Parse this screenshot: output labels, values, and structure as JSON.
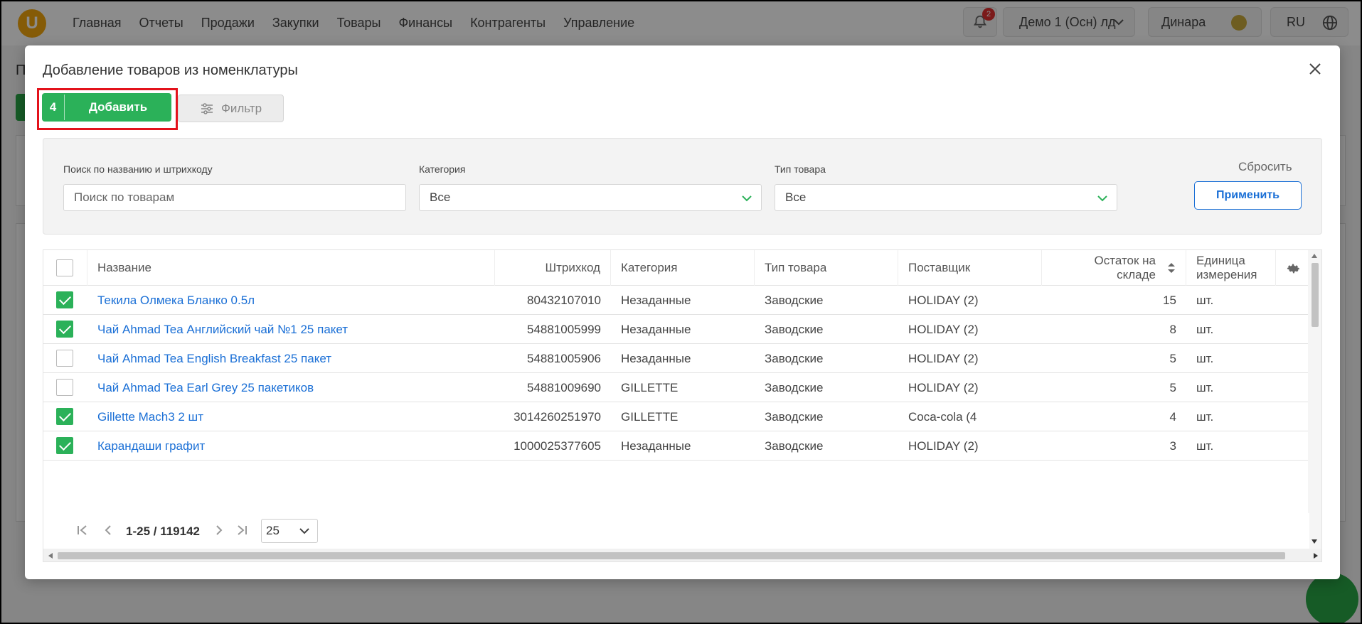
{
  "app": {
    "logo_letter": "U",
    "nav": [
      "Главная",
      "Отчеты",
      "Продажи",
      "Закупки",
      "Товары",
      "Финансы",
      "Контрагенты",
      "Управление"
    ],
    "notifications_count": "2",
    "company": "Демо 1 (Осн) лд",
    "user": "Динара",
    "language": "RU"
  },
  "background": {
    "title_fragment": "П"
  },
  "modal": {
    "title": "Добавление товаров из номенклатуры",
    "add_count": "4",
    "add_label": "Добавить",
    "filter_label": "Фильтр",
    "filters": {
      "search_label": "Поиск по названию и штрихкоду",
      "search_placeholder": "Поиск по товарам",
      "category_label": "Категория",
      "category_value": "Все",
      "type_label": "Тип товара",
      "type_value": "Все",
      "reset_label": "Сбросить",
      "apply_label": "Применить"
    },
    "table": {
      "columns": [
        "Название",
        "Штрихкод",
        "Категория",
        "Тип товара",
        "Поставщик",
        "Остаток на складе",
        "Единица измерения"
      ],
      "rows": [
        {
          "checked": true,
          "name": "Текила Олмека Бланко 0.5л",
          "barcode": "80432107010",
          "category": "Незаданные",
          "type": "Заводские",
          "supplier": "HOLIDAY (2)",
          "stock": "15",
          "unit": "шт."
        },
        {
          "checked": true,
          "name": "Чай Ahmad Tea Английский чай №1 25 пакет",
          "barcode": "54881005999",
          "category": "Незаданные",
          "type": "Заводские",
          "supplier": "HOLIDAY (2)",
          "stock": "8",
          "unit": "шт."
        },
        {
          "checked": false,
          "name": "Чай Ahmad Tea English Breakfast 25 пакет",
          "barcode": "54881005906",
          "category": "Незаданные",
          "type": "Заводские",
          "supplier": "HOLIDAY (2)",
          "stock": "5",
          "unit": "шт."
        },
        {
          "checked": false,
          "name": "Чай Ahmad Tea Earl Grey 25 пакетиков",
          "barcode": "54881009690",
          "category": "GILLETTE",
          "type": "Заводские",
          "supplier": "HOLIDAY (2)",
          "stock": "5",
          "unit": "шт."
        },
        {
          "checked": true,
          "name": "Gillette Mach3 2 шт",
          "barcode": "3014260251970",
          "category": "GILLETTE",
          "type": "Заводские",
          "supplier": "Coca-cola (4",
          "stock": "4",
          "unit": "шт."
        },
        {
          "checked": true,
          "name": "Карандаши графит",
          "barcode": "1000025377605",
          "category": "Незаданные",
          "type": "Заводские",
          "supplier": "HOLIDAY (2)",
          "stock": "3",
          "unit": "шт."
        }
      ]
    },
    "pagination": {
      "range": "1-25 / 119142",
      "page_size": "25"
    }
  },
  "colors": {
    "accent_green": "#2bb159",
    "link_blue": "#1a6fd6",
    "highlight_red": "#e3121b",
    "logo_orange": "#f2a60d"
  }
}
